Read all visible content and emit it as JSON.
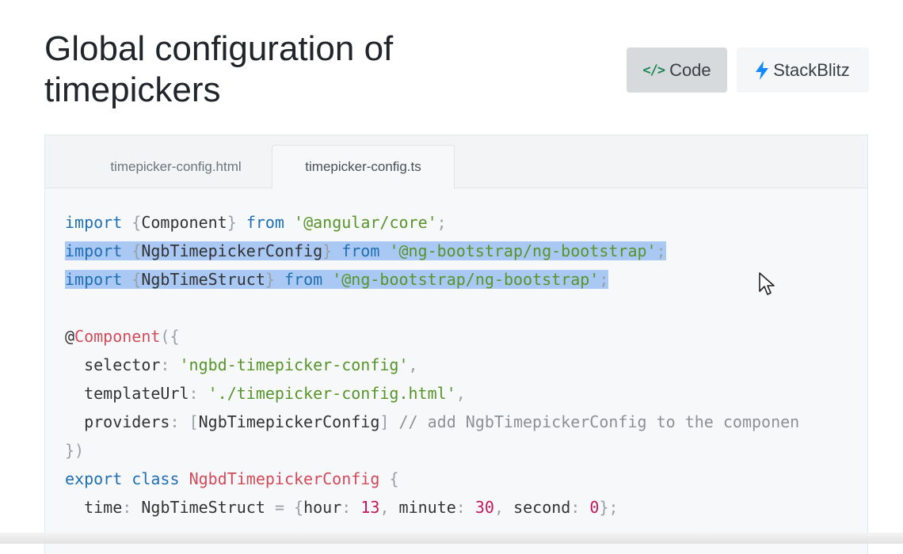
{
  "header": {
    "title": "Global configuration of timepickers",
    "code_button": {
      "icon": "</>",
      "label": "Code"
    },
    "stackblitz_button": {
      "icon": "bolt-icon",
      "label": "StackBlitz"
    }
  },
  "tabs": [
    {
      "label": "timepicker-config.html",
      "active": false
    },
    {
      "label": "timepicker-config.ts",
      "active": true
    }
  ],
  "code_lines": [
    "import {Component} from '@angular/core';",
    "import {NgbTimepickerConfig} from '@ng-bootstrap/ng-bootstrap';",
    "import {NgbTimeStruct} from '@ng-bootstrap/ng-bootstrap';",
    "",
    "@Component({",
    "  selector: 'ngbd-timepicker-config',",
    "  templateUrl: './timepicker-config.html',",
    "  providers: [NgbTimepickerConfig] // add NgbTimepickerConfig to the componen",
    "})",
    "export class NgbdTimepickerConfig {",
    "  time: NgbTimeStruct = {hour: 13, minute: 30, second: 0};"
  ],
  "selection": {
    "highlighted_lines": [
      2,
      3
    ]
  },
  "colors": {
    "keyword": "#1f6fb2",
    "string": "#57952a",
    "decorator": "#d24b5b",
    "number": "#c2185b",
    "comment": "#8c9196",
    "selection": "#a9c8f3",
    "code_icon": "#198754"
  }
}
